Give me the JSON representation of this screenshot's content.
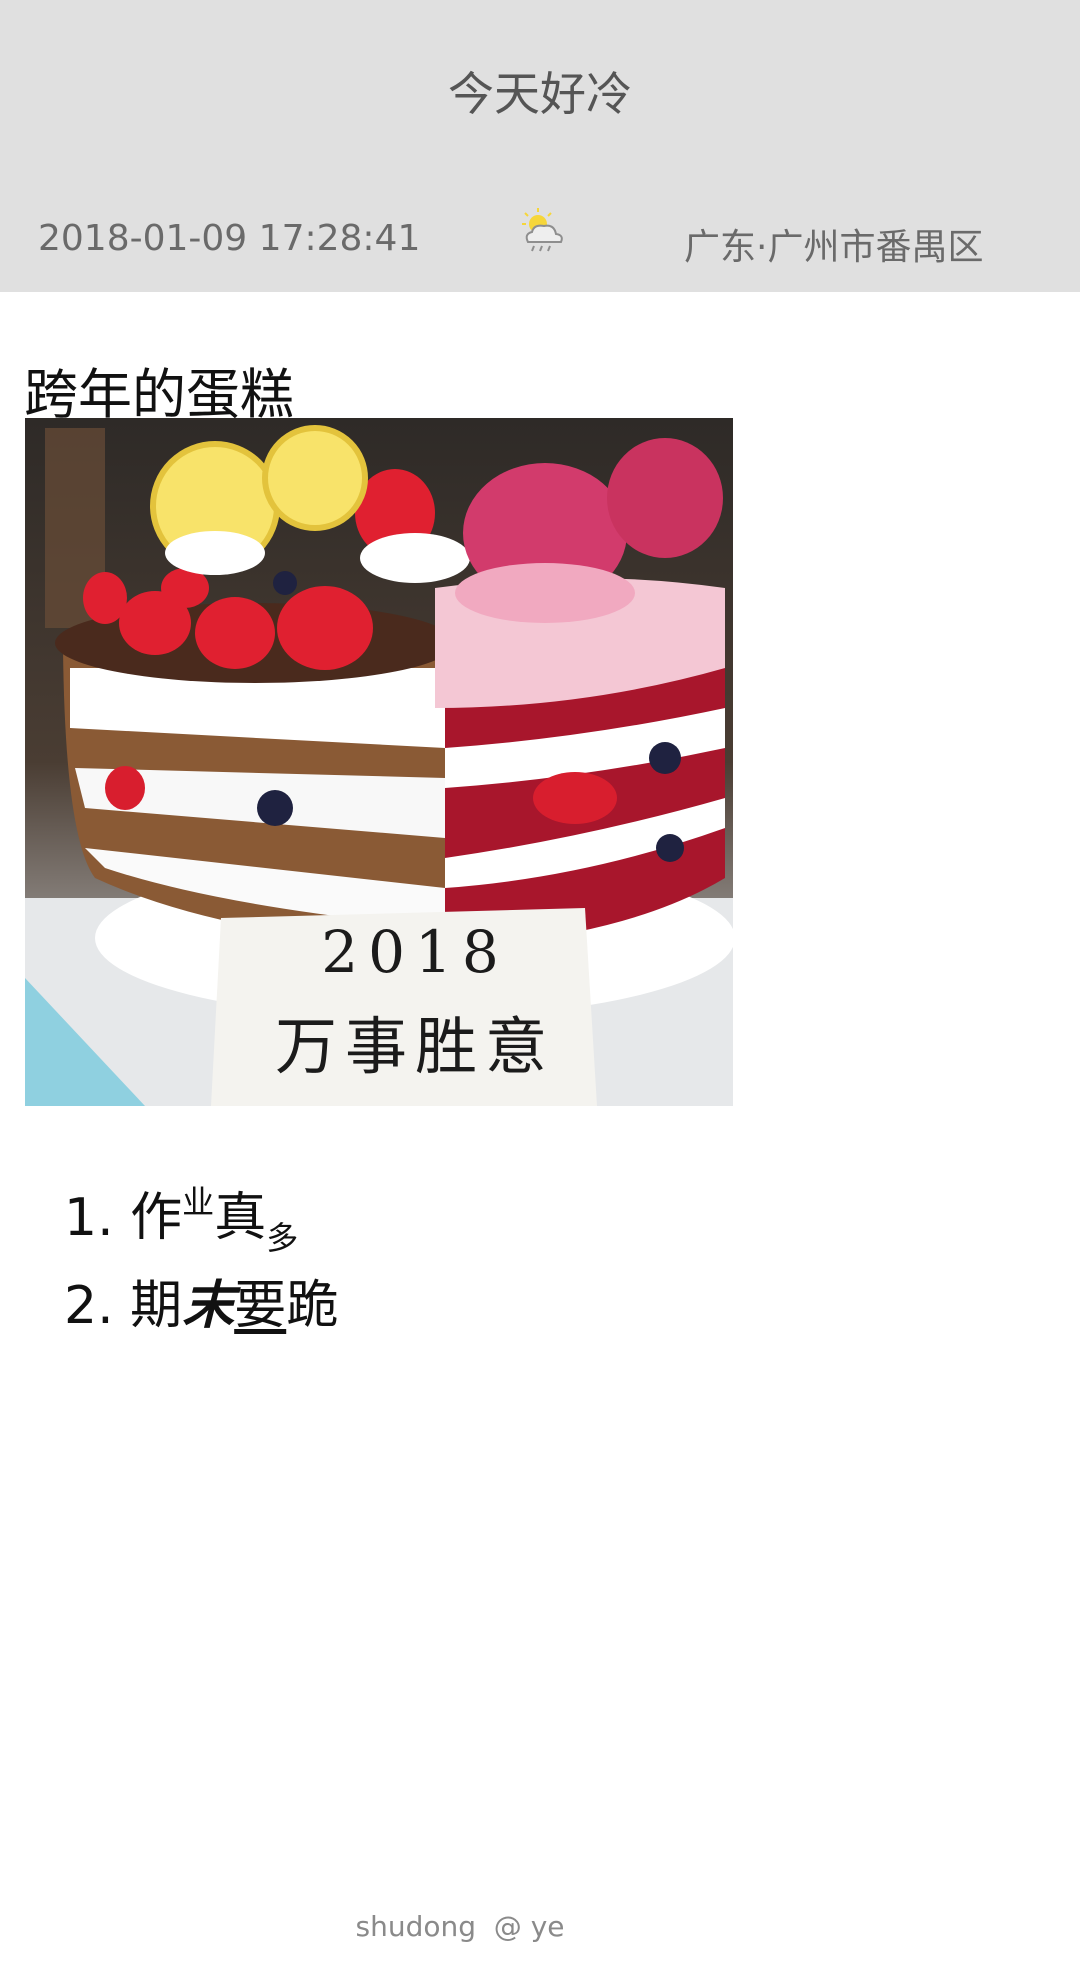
{
  "header": {
    "title": "今天好冷",
    "date": "2018-01-09 17:28:41",
    "weather_icon": "partly-cloudy-rain-icon",
    "location": "广东·广州市番禺区"
  },
  "note": {
    "title": "跨年的蛋糕",
    "photo": {
      "icon": "cake-photo",
      "plaque_line1": "2018",
      "plaque_line2": "万事胜意"
    },
    "list": [
      {
        "num": "1.",
        "part1": "作",
        "sup": "业",
        "part2": "真",
        "sub": "多"
      },
      {
        "num": "2.",
        "part1": "期",
        "bold": "末",
        "underline": "要",
        "part2": "跪"
      }
    ]
  },
  "footer": {
    "text": "shudong  @ ye"
  }
}
